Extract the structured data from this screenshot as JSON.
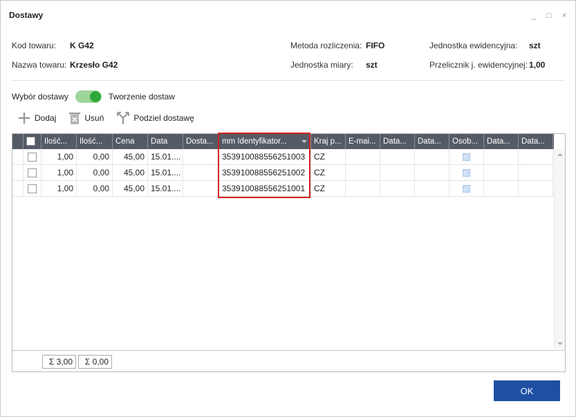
{
  "window": {
    "title": "Dostawy",
    "controls": [
      "_",
      "□",
      "×"
    ]
  },
  "info": {
    "kod_label": "Kod towaru:",
    "kod_value": "K G42",
    "nazwa_label": "Nazwa towaru:",
    "nazwa_value": "Krzesło G42",
    "metoda_label": "Metoda rozliczenia:",
    "metoda_value": "FIFO",
    "jm_label": "Jednostka miary:",
    "jm_value": "szt",
    "je_label": "Jednostka ewidencyjna:",
    "je_value": "szt",
    "prz_label": "Przelicznik j. ewidencyjnej:",
    "prz_value": "1,00"
  },
  "toggle": {
    "left_label": "Wybór dostawy",
    "right_label": "Tworzenie dostaw",
    "state": "on"
  },
  "toolbar": {
    "add": "Dodaj",
    "remove": "Usuń",
    "split": "Podziel dostawę"
  },
  "table": {
    "columns": [
      "Ilość...",
      "Ilość...",
      "Cena",
      "Data",
      "Dosta...",
      "mm Identyfikator...",
      "Kraj p...",
      "E-mai...",
      "Data...",
      "Data...",
      "Osob...",
      "Data...",
      "Data..."
    ],
    "rows": [
      {
        "ilosc1": "1,00",
        "ilosc2": "0,00",
        "cena": "45,00",
        "data": "15.01....",
        "dosta": "",
        "identyfikator": "353910088556251003",
        "kraj": "CZ"
      },
      {
        "ilosc1": "1,00",
        "ilosc2": "0,00",
        "cena": "45,00",
        "data": "15.01....",
        "dosta": "",
        "identyfikator": "353910088556251002",
        "kraj": "CZ"
      },
      {
        "ilosc1": "1,00",
        "ilosc2": "0,00",
        "cena": "45,00",
        "data": "15.01....",
        "dosta": "",
        "identyfikator": "353910088556251001",
        "kraj": "CZ"
      }
    ],
    "sum1": "Σ 3,00",
    "sum2": "Σ 0,00"
  },
  "buttons": {
    "ok": "OK"
  },
  "colors": {
    "header_bg": "#545b66",
    "accent": "#1f4fa3",
    "toggle_on": "#2fa83a",
    "highlight": "#d62020"
  }
}
